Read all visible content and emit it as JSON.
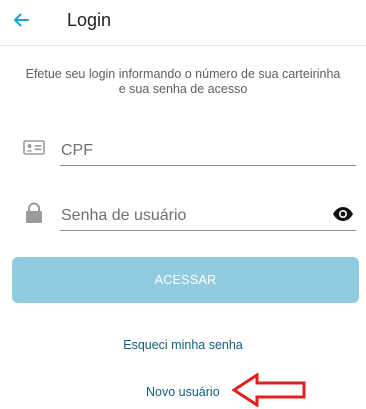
{
  "header": {
    "title": "Login",
    "back_icon": "arrow-left-icon",
    "accent_color": "#1a9fd9"
  },
  "intro": {
    "line1": "Efetue seu login informando o número de sua carteirinha",
    "line2": "e sua senha de acesso"
  },
  "form": {
    "cpf": {
      "placeholder": "CPF",
      "value": "",
      "icon": "id-card-icon"
    },
    "password": {
      "placeholder": "Senha de usuário",
      "value": "",
      "icon": "lock-icon",
      "toggle_icon": "eye-icon"
    },
    "submit_label": "ACESSAR",
    "submit_color": "#90cbe0"
  },
  "links": {
    "forgot_password": "Esqueci minha senha",
    "new_user": "Novo usuário",
    "color": "#0f5f80"
  },
  "annotation": {
    "icon": "red-arrow-icon",
    "color": "#e02020"
  }
}
